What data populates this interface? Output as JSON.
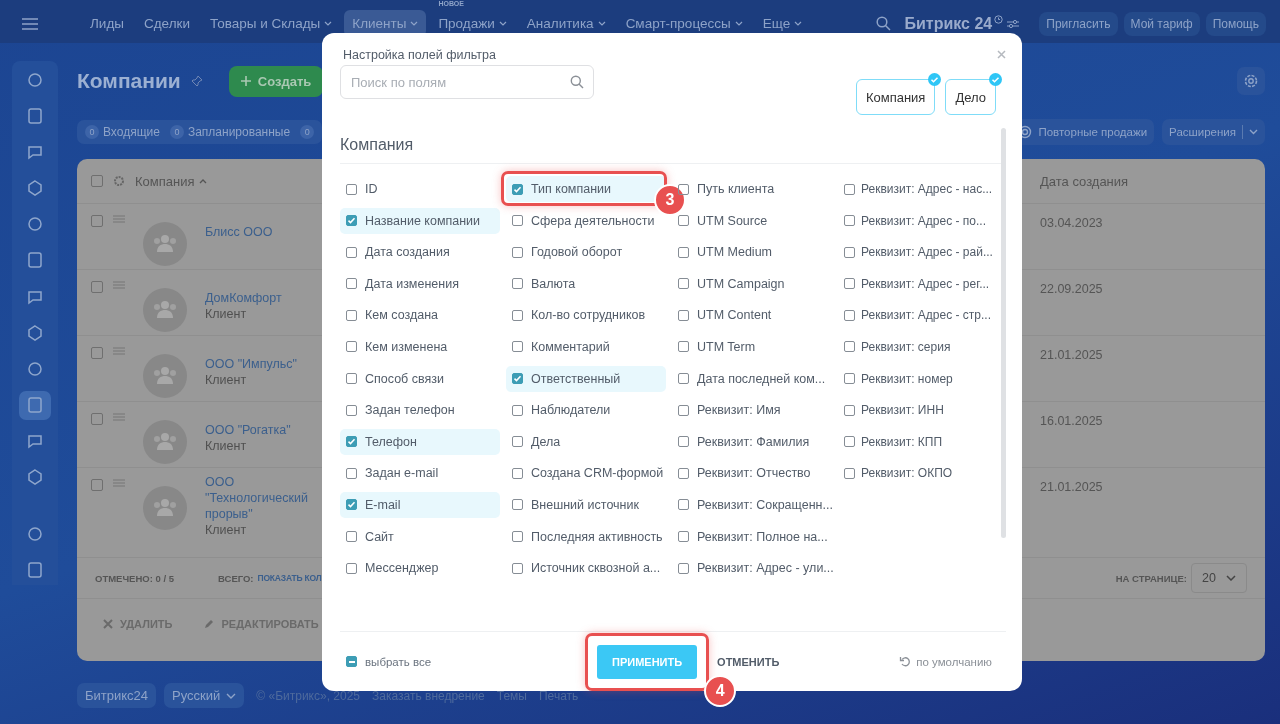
{
  "topbar": {
    "nav": [
      {
        "label": "Лиды",
        "dropdown": false,
        "selected": false
      },
      {
        "label": "Сделки",
        "dropdown": false,
        "selected": false
      },
      {
        "label": "Товары и Склады",
        "dropdown": true,
        "selected": false
      },
      {
        "label": "Клиенты",
        "dropdown": true,
        "selected": true
      },
      {
        "label": "Продажи",
        "dropdown": true,
        "selected": false,
        "badge": "НОВОЕ"
      },
      {
        "label": "Аналитика",
        "dropdown": true,
        "selected": false
      },
      {
        "label": "Смарт-процессы",
        "dropdown": true,
        "selected": false
      },
      {
        "label": "Еще",
        "dropdown": true,
        "selected": false
      }
    ],
    "logo": "Битрикс 24",
    "buttons": [
      "Пригласить",
      "Мой тариф",
      "Помощь"
    ]
  },
  "sidebar": {
    "items": [
      {
        "selected": false
      },
      {
        "selected": false
      },
      {
        "selected": false
      },
      {
        "selected": false
      },
      {
        "selected": false
      },
      {
        "selected": false
      },
      {
        "selected": false
      },
      {
        "selected": false
      },
      {
        "selected": false
      },
      {
        "selected": true
      },
      {
        "selected": false
      },
      {
        "selected": false
      },
      {
        "selected": false
      },
      {
        "selected": false
      }
    ]
  },
  "page": {
    "title": "Компании",
    "create_button": "Создать",
    "counters": [
      {
        "count": "0",
        "label": "Входящие"
      },
      {
        "count": "0",
        "label": "Запланированные"
      },
      {
        "count": "0"
      }
    ],
    "right_buttons": [
      "Повторные продажи",
      "Расширения"
    ]
  },
  "table": {
    "columns": [
      "Компания",
      "Дата создания"
    ],
    "all_checked": false,
    "rows": [
      {
        "name": "Блисс ООО",
        "checked": false,
        "date": "03.04.2023"
      },
      {
        "name": "ДомКомфорт",
        "type": "Клиент",
        "checked": false,
        "date": "22.09.2025"
      },
      {
        "name": "ООО \"Импульс\"",
        "type": "Клиент",
        "checked": false,
        "date": "21.01.2025"
      },
      {
        "name": "ООО \"Рогатка\"",
        "type": "Клиент",
        "checked": false,
        "date": "16.01.2025"
      },
      {
        "name": "ООО \"Технологический прорыв\"",
        "type": "Клиент",
        "checked": false,
        "date": "21.01.2025"
      }
    ],
    "selected_label": "ОТМЕЧЕНО:",
    "selected_value": "0 / 5",
    "total_label": "ВСЕГО:",
    "total_link": "ПОКАЗАТЬ КОЛ",
    "per_page_label": "НА СТРАНИЦЕ:",
    "per_page": "20",
    "actions": [
      "УДАЛИТЬ",
      "РЕДАКТИРОВАТЬ"
    ]
  },
  "footer": {
    "brand": "Битрикс24",
    "language": "Русский",
    "copyright": "© «Битрикс», 2025",
    "links": [
      "Заказать внедрение",
      "Темы",
      "Печать"
    ]
  },
  "dialog": {
    "title": "Настройка полей фильтра",
    "search": {
      "placeholder": "Поиск по полям"
    },
    "entities": [
      {
        "label": "Компания",
        "selected": true
      },
      {
        "label": "Дело",
        "selected": true
      }
    ],
    "section": "Компания",
    "columns": [
      [
        {
          "label": "ID",
          "checked": false
        },
        {
          "label": "Название компании",
          "checked": true
        },
        {
          "label": "Дата создания",
          "checked": false
        },
        {
          "label": "Дата изменения",
          "checked": false
        },
        {
          "label": "Кем создана",
          "checked": false
        },
        {
          "label": "Кем изменена",
          "checked": false
        },
        {
          "label": "Способ связи",
          "checked": false
        },
        {
          "label": "Задан телефон",
          "checked": false
        },
        {
          "label": "Телефон",
          "checked": true
        },
        {
          "label": "Задан e-mail",
          "checked": false
        },
        {
          "label": "E-mail",
          "checked": true
        },
        {
          "label": "Сайт",
          "checked": false
        },
        {
          "label": "Мессенджер",
          "checked": false
        }
      ],
      [
        {
          "label": "Тип компании",
          "checked": true,
          "callout": "3"
        },
        {
          "label": "Сфера деятельности",
          "checked": false
        },
        {
          "label": "Годовой оборот",
          "checked": false
        },
        {
          "label": "Валюта",
          "checked": false
        },
        {
          "label": "Кол-во сотрудников",
          "checked": false
        },
        {
          "label": "Комментарий",
          "checked": false
        },
        {
          "label": "Ответственный",
          "checked": true
        },
        {
          "label": "Наблюдатели",
          "checked": false
        },
        {
          "label": "Дела",
          "checked": false
        },
        {
          "label": "Создана CRM-формой",
          "checked": false
        },
        {
          "label": "Внешний источник",
          "checked": false
        },
        {
          "label": "Последняя активность",
          "checked": false
        },
        {
          "label": "Источник сквозной а...",
          "checked": false
        }
      ],
      [
        {
          "label": "Путь клиента",
          "checked": false
        },
        {
          "label": "UTM Source",
          "checked": false
        },
        {
          "label": "UTM Medium",
          "checked": false
        },
        {
          "label": "UTM Campaign",
          "checked": false
        },
        {
          "label": "UTM Content",
          "checked": false
        },
        {
          "label": "UTM Term",
          "checked": false
        },
        {
          "label": "Дата последней ком...",
          "checked": false
        },
        {
          "label": "Реквизит: Имя",
          "checked": false
        },
        {
          "label": "Реквизит: Фамилия",
          "checked": false
        },
        {
          "label": "Реквизит: Отчество",
          "checked": false
        },
        {
          "label": "Реквизит: Сокращенн...",
          "checked": false
        },
        {
          "label": "Реквизит: Полное на...",
          "checked": false
        },
        {
          "label": "Реквизит: Адрес - ули...",
          "checked": false
        }
      ],
      [
        {
          "label": "Реквизит: Адрес - нас...",
          "checked": false
        },
        {
          "label": "Реквизит: Адрес - по...",
          "checked": false
        },
        {
          "label": "Реквизит: Адрес - рай...",
          "checked": false
        },
        {
          "label": "Реквизит: Адрес - рег...",
          "checked": false
        },
        {
          "label": "Реквизит: Адрес - стр...",
          "checked": false
        },
        {
          "label": "Реквизит: серия",
          "checked": false
        },
        {
          "label": "Реквизит: номер",
          "checked": false
        },
        {
          "label": "Реквизит: ИНН",
          "checked": false
        },
        {
          "label": "Реквизит: КПП",
          "checked": false
        },
        {
          "label": "Реквизит: ОКПО",
          "checked": false
        }
      ]
    ],
    "select_all": {
      "label": "выбрать все",
      "indeterminate": true
    },
    "apply": {
      "label": "ПРИМЕНИТЬ",
      "callout": "4"
    },
    "cancel": "ОТМЕНИТЬ",
    "reset": "по умолчанию"
  }
}
